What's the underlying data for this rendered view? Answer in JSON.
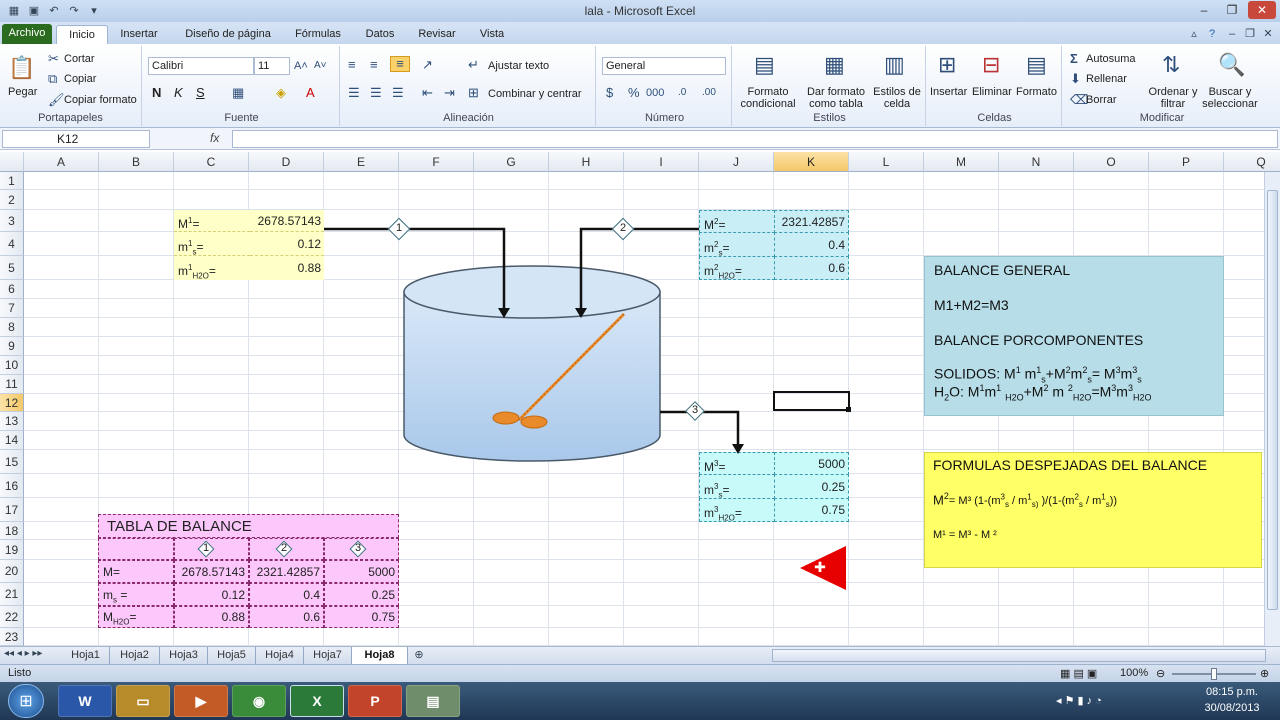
{
  "window": {
    "title": "lala  -  Microsoft Excel"
  },
  "tabs": {
    "file": "Archivo",
    "items": [
      "Inicio",
      "Insertar",
      "Diseño de página",
      "Fórmulas",
      "Datos",
      "Revisar",
      "Vista"
    ]
  },
  "ribbon": {
    "clipboard": {
      "paste": "Pegar",
      "cut": "Cortar",
      "copy": "Copiar",
      "format_painter": "Copiar formato",
      "label": "Portapapeles"
    },
    "font": {
      "name": "Calibri",
      "size": "11",
      "label": "Fuente"
    },
    "alignment": {
      "wrap": "Ajustar texto",
      "merge": "Combinar y centrar",
      "label": "Alineación"
    },
    "number": {
      "format": "General",
      "label": "Número"
    },
    "styles": {
      "conditional": "Formato condicional",
      "table": "Dar formato como tabla",
      "cell": "Estilos de celda",
      "label": "Estilos"
    },
    "cells": {
      "insert": "Insertar",
      "delete": "Eliminar",
      "format": "Formato",
      "label": "Celdas"
    },
    "editing": {
      "autosum": "Autosuma",
      "fill": "Rellenar",
      "clear": "Borrar",
      "sort": "Ordenar y filtrar",
      "find": "Buscar y seleccionar",
      "label": "Modificar"
    }
  },
  "formula_bar": {
    "name_box": "K12",
    "fx": "fx",
    "value": ""
  },
  "columns": [
    "A",
    "B",
    "C",
    "D",
    "E",
    "F",
    "G",
    "H",
    "I",
    "J",
    "K",
    "L",
    "M",
    "N",
    "O",
    "P",
    "Q"
  ],
  "rows": [
    "1",
    "2",
    "3",
    "4",
    "5",
    "6",
    "7",
    "8",
    "9",
    "10",
    "11",
    "12",
    "13",
    "14",
    "15",
    "16",
    "17",
    "18",
    "19",
    "20",
    "21",
    "22",
    "23"
  ],
  "stream1": {
    "m_label": "M",
    "m_sup": "1",
    "m_eq": "=",
    "m_val": "2678.57143",
    "ms_label": "m",
    "ms_sup": "1",
    "ms_sub": "s",
    "ms_val": "0.12",
    "mw_label": "m",
    "mw_sup": "1",
    "mw_sub": "H2O",
    "mw_val": "0.88"
  },
  "stream2": {
    "m_label": "M",
    "m_sup": "2",
    "m_eq": "=",
    "m_val": "2321.42857",
    "ms_label": "m",
    "ms_sup": "2",
    "ms_sub": "s",
    "ms_val": "0.4",
    "mw_label": "m",
    "mw_sup": "2",
    "mw_sub": "H2O",
    "mw_val": "0.6"
  },
  "stream3": {
    "m_label": "M",
    "m_sup": "3",
    "m_eq": "=",
    "m_val": "5000",
    "ms_label": "m",
    "ms_sup": "3",
    "ms_sub": "s",
    "ms_val": "0.25",
    "mw_label": "m",
    "mw_sup": "3",
    "mw_sub": "H2O",
    "mw_val": "0.75"
  },
  "markers": [
    "1",
    "2",
    "3"
  ],
  "balance_box": {
    "title": "BALANCE GENERAL",
    "eq": "M1+M2=M3",
    "comp_title": "BALANCE PORCOMPONENTES",
    "solids": "SOLIDOS:",
    "water": "H"
  },
  "formulas_box": {
    "title": "FORMULAS DESPEJADAS DEL BALANCE",
    "m1": "M¹ = M³ - M ²"
  },
  "table": {
    "title": "TABLA DE BALANCE",
    "rows": [
      {
        "label": "M=",
        "values": [
          "2678.57143",
          "2321.42857",
          "5000"
        ]
      },
      {
        "label": "m",
        "sub": "s",
        "values": [
          "0.12",
          "0.4",
          "0.25"
        ]
      },
      {
        "label": "M",
        "sub": "H2O",
        "values": [
          "0.88",
          "0.6",
          "0.75"
        ]
      }
    ]
  },
  "sheets": [
    "Hoja1",
    "Hoja2",
    "Hoja3",
    "Hoja5",
    "Hoja4",
    "Hoja7",
    "Hoja8"
  ],
  "status": {
    "ready": "Listo",
    "zoom": "100%"
  },
  "taskbar": {
    "time": "08:15 p.m.",
    "date": "30/08/2013"
  },
  "colors": {
    "yellow": "#ffffc8",
    "blue": "#c9eef6",
    "cyan": "#c8fafa",
    "pink": "#fcc8fc",
    "tank": "#bcd6ef",
    "note_yellow": "#ffff66",
    "note_blue": "#b7dde8"
  }
}
